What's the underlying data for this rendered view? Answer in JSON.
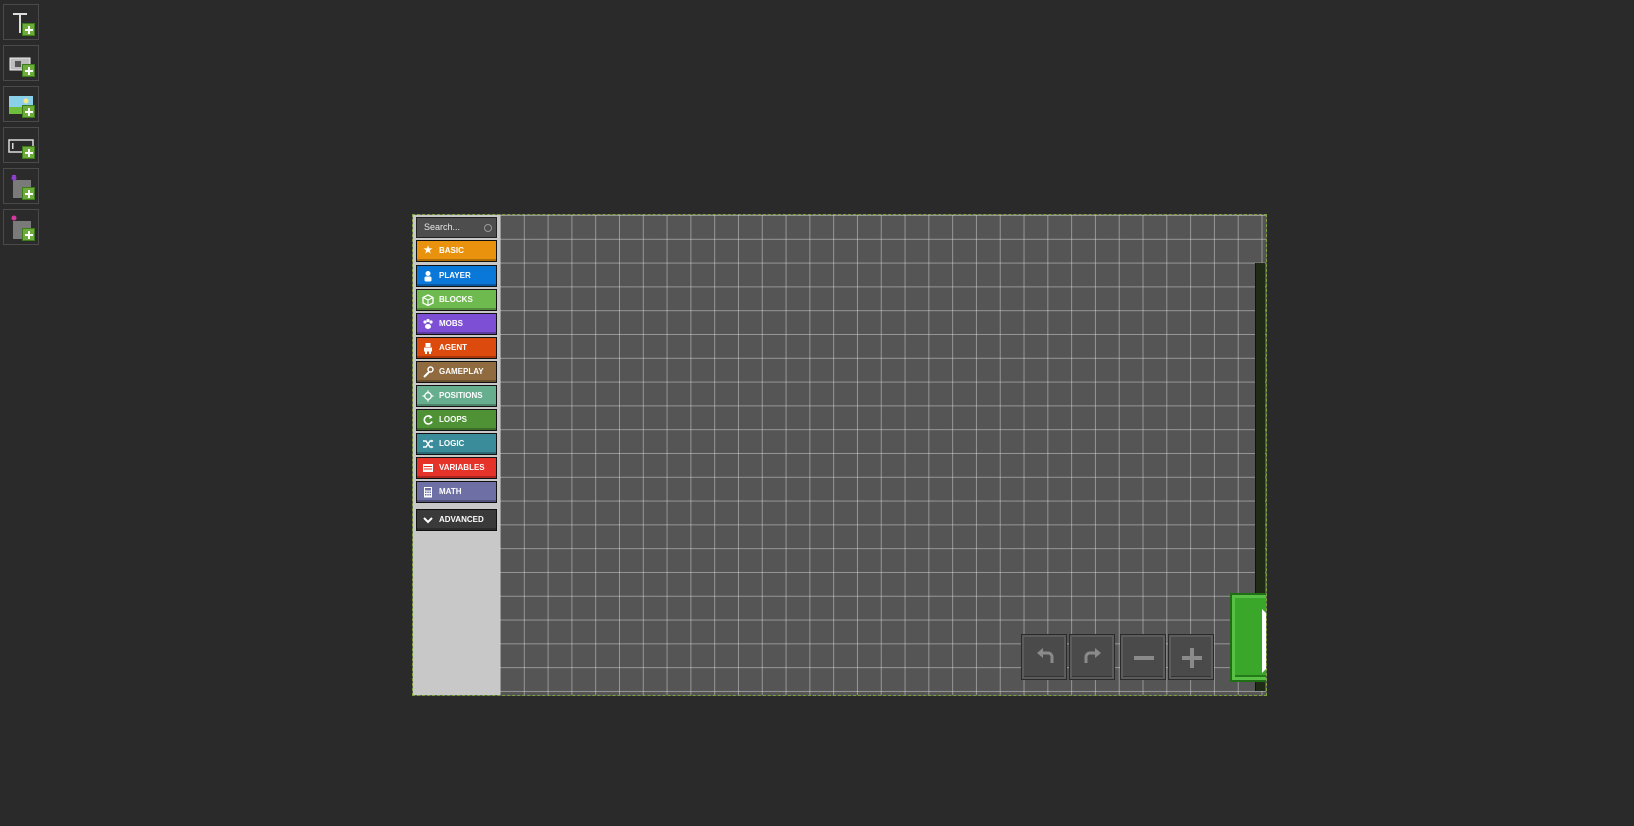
{
  "palette": {
    "tools": [
      {
        "name": "add-text-tool",
        "icon": "text-add-icon"
      },
      {
        "name": "add-button-tool",
        "icon": "button-add-icon"
      },
      {
        "name": "add-image-tool",
        "icon": "image-add-icon"
      },
      {
        "name": "add-textbox-tool",
        "icon": "textbox-add-icon"
      },
      {
        "name": "add-purple-sprite-tool",
        "icon": "sprite-purple-add-icon"
      },
      {
        "name": "add-pink-sprite-tool",
        "icon": "sprite-pink-add-icon"
      }
    ]
  },
  "editor": {
    "search_placeholder": "Search...",
    "categories": [
      {
        "label": "BASIC",
        "color": "#e9920d",
        "icon": "star-icon"
      },
      {
        "label": "PLAYER",
        "color": "#0a78d9",
        "icon": "person-icon"
      },
      {
        "label": "BLOCKS",
        "color": "#6fba4f",
        "icon": "cube-icon"
      },
      {
        "label": "MOBS",
        "color": "#7c4fd5",
        "icon": "paw-icon"
      },
      {
        "label": "AGENT",
        "color": "#dd4a0e",
        "icon": "robot-icon"
      },
      {
        "label": "GAMEPLAY",
        "color": "#8f6b3f",
        "icon": "wrench-icon"
      },
      {
        "label": "POSITIONS",
        "color": "#67ae8f",
        "icon": "crosshair-icon"
      },
      {
        "label": "LOOPS",
        "color": "#4f9236",
        "icon": "refresh-icon"
      },
      {
        "label": "LOGIC",
        "color": "#3a8c9b",
        "icon": "shuffle-icon"
      },
      {
        "label": "VARIABLES",
        "color": "#e5332a",
        "icon": "list-icon"
      },
      {
        "label": "MATH",
        "color": "#6d6fa5",
        "icon": "calculator-icon"
      }
    ],
    "advanced": {
      "label": "ADVANCED",
      "color": "#3a3a3a",
      "icon": "chevron-down-icon"
    },
    "controls": [
      "undo-icon",
      "redo-icon",
      "zoom-out-icon",
      "zoom-in-icon"
    ],
    "run_icon": "play-icon",
    "accent_color": "#3aa72a"
  }
}
